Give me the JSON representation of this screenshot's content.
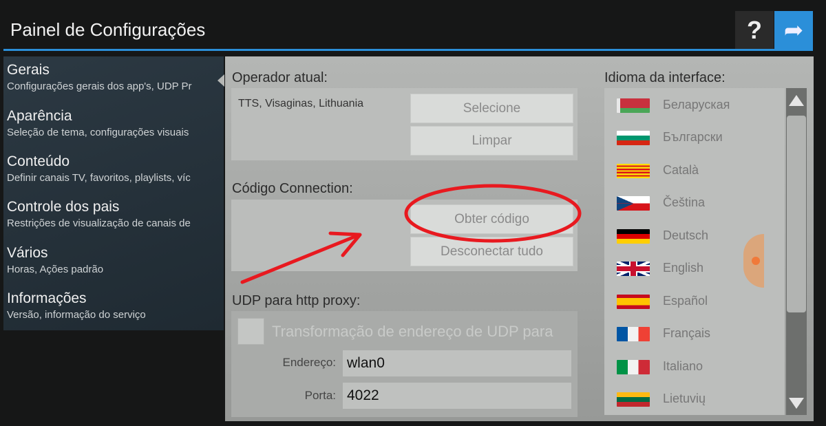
{
  "header": {
    "title": "Painel de Configurações",
    "help_icon": "question-mark-icon",
    "share_icon": "share-arrow-icon",
    "accent_color": "#2b8fd9"
  },
  "sidebar": {
    "items": [
      {
        "title": "Gerais",
        "subtitle": "Configurações gerais dos app's, UDP Pr"
      },
      {
        "title": "Aparência",
        "subtitle": "Seleção de tema, configurações visuais"
      },
      {
        "title": "Conteúdo",
        "subtitle": "Definir canais TV, favoritos, playlists, víc"
      },
      {
        "title": "Controle dos pais",
        "subtitle": "Restrições de visualização de canais de"
      },
      {
        "title": "Vários",
        "subtitle": "Horas, Ações padrão"
      },
      {
        "title": "Informações",
        "subtitle": "Versão, informação do serviço"
      }
    ]
  },
  "operator": {
    "label": "Operador atual:",
    "value": "TTS, Visaginas, Lithuania",
    "select_label": "Selecione",
    "clear_label": "Limpar"
  },
  "connection": {
    "label": "Código Connection:",
    "get_code_label": "Obter código",
    "disconnect_label": "Desconectar tudo"
  },
  "udp": {
    "label": "UDP para http proxy:",
    "checkbox_label": "Transformação de endereço de UDP para",
    "checked": false,
    "address_label": "Endereço:",
    "address_value": "wlan0",
    "port_label": "Porta:",
    "port_value": "4022"
  },
  "language": {
    "label": "Idioma da interface:",
    "items": [
      {
        "name": "Беларуская",
        "flag": "belarus-flag"
      },
      {
        "name": "Български",
        "flag": "bulgaria-flag"
      },
      {
        "name": "Català",
        "flag": "catalonia-flag"
      },
      {
        "name": "Čeština",
        "flag": "czech-flag"
      },
      {
        "name": "Deutsch",
        "flag": "germany-flag"
      },
      {
        "name": "English",
        "flag": "uk-flag"
      },
      {
        "name": "Español",
        "flag": "spain-flag"
      },
      {
        "name": "Français",
        "flag": "france-flag"
      },
      {
        "name": "Italiano",
        "flag": "italy-flag"
      },
      {
        "name": "Lietuvių",
        "flag": "lithuania-flag"
      }
    ]
  },
  "annotation_color": "#e8191f"
}
